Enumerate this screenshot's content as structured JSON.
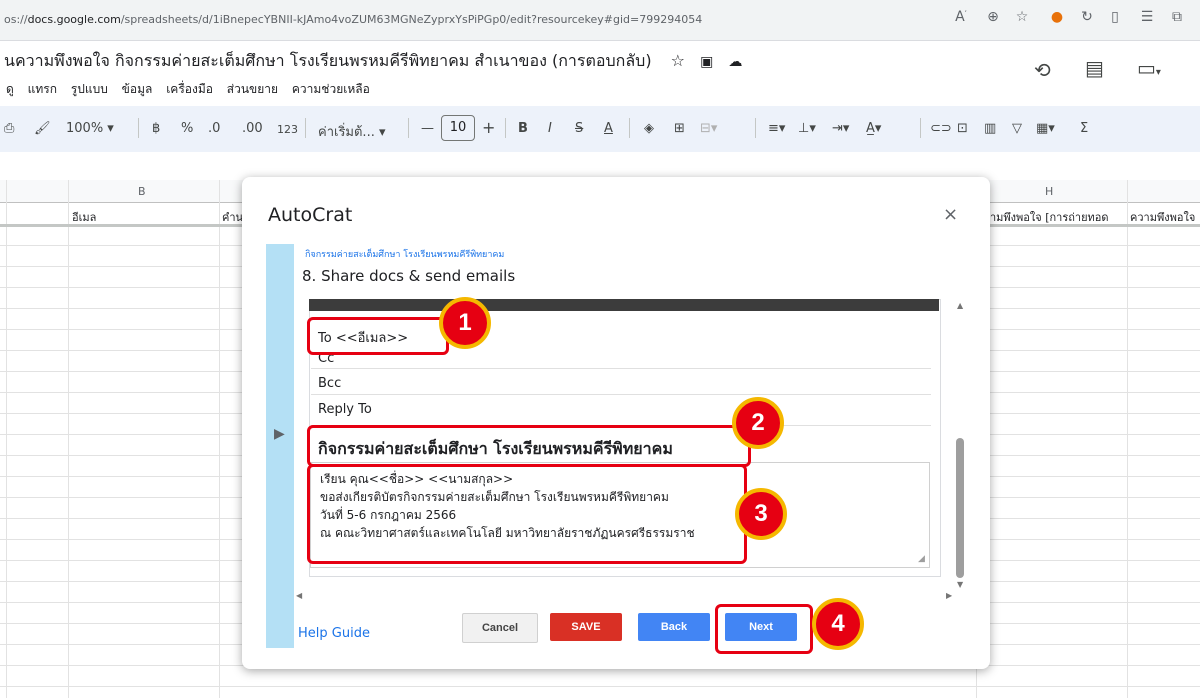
{
  "browser": {
    "url_prefix": "os://",
    "url_domain": "docs.google.com",
    "url_path": "/spreadsheets/d/1iBnepecYBNII-kJAmo4voZUM63MGNeZyprxYsPiPGp0/edit?resourcekey#gid=799294054"
  },
  "sheet": {
    "title": "นความพึงพอใจ กิจกรรมค่ายสะเต็มศึกษา โรงเรียนพรหมคีรีพิทยาคม สำเนาของ (การตอบกลับ)",
    "menu": [
      "ดู",
      "แทรก",
      "รูปแบบ",
      "ข้อมูล",
      "เครื่องมือ",
      "ส่วนขยาย",
      "ความช่วยเหลือ"
    ],
    "toolbar": {
      "zoom": "100%",
      "currency": "฿",
      "percent": "%",
      "dec_less": ".0",
      "dec_more": ".00",
      "number_fmt": "123",
      "font": "ค่าเริ่มต้... ▾",
      "font_size": "10",
      "bold": "B",
      "italic": "I",
      "sigma": "Σ"
    },
    "columns": {
      "b": "B",
      "h": "H"
    },
    "row1": {
      "b": "อีเมล",
      "c": "คำน",
      "h": "ามพึงพอใจ [การถ่ายทอด",
      "i": "ความพึงพอใจ"
    }
  },
  "dialog": {
    "title": "AutoCrat",
    "close": "×",
    "breadcrumb": "กิจกรรมค่ายสะเต็มศึกษา โรงเรียนพรหมคีรีพิทยาคม",
    "step": "8. Share docs & send emails",
    "to": "To  <<อีเมล>>",
    "cc": "Cc",
    "bcc": "Bcc",
    "reply_to": "Reply To",
    "subject": "กิจกรรมค่ายสะเต็มศึกษา โรงเรียนพรหมคีรีพิทยาคม",
    "body_lines": [
      "เรียน คุณ<<ชื่อ>> <<นามสกุล>>",
      "ขอส่งเกียรติบัตรกิจกรรมค่ายสะเต็มศึกษา โรงเรียนพรหมคีรีพิทยาคม",
      "วันที่ 5-6 กรกฎาคม 2566",
      "ณ คณะวิทยาศาสตร์และเทคโนโลยี มหาวิทยาลัยราชภัฏนครศรีธรรมราช"
    ],
    "help": "Help Guide",
    "buttons": {
      "cancel": "Cancel",
      "save": "SAVE",
      "back": "Back",
      "next": "Next"
    }
  },
  "annotations": {
    "b1": "1",
    "b2": "2",
    "b3": "3",
    "b4": "4"
  },
  "colors": {
    "accent_red": "#e60012",
    "badge_ring": "#f5b800",
    "save": "#d93025",
    "next": "#4285f4",
    "sidebar": "#b4e0f5"
  }
}
